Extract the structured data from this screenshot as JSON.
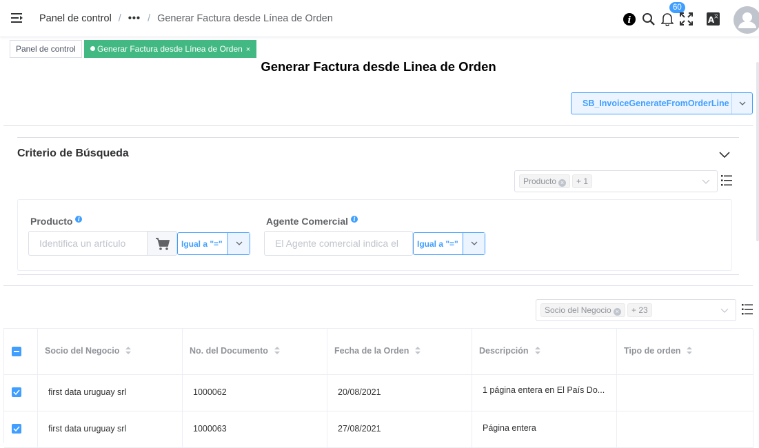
{
  "breadcrumb": {
    "home": "Panel de control",
    "ellipsis": "•••",
    "current": "Generar Factura desde Línea de Orden"
  },
  "header": {
    "notifications_count": "60"
  },
  "tabs": [
    {
      "label": "Panel de control",
      "active": false
    },
    {
      "label": "Generar Factura desde Línea de Orden",
      "active": true,
      "close": "×"
    }
  ],
  "page_title": "Generar Factura desde Linea de Orden",
  "process_select": {
    "value": "SB_InvoiceGenerateFromOrderLine"
  },
  "search_criteria": {
    "title": "Criterio de Búsqueda",
    "field_selector": {
      "chip": "Producto",
      "more": "+ 1"
    },
    "fields": {
      "product": {
        "label": "Producto",
        "placeholder": "Identifica un artículo",
        "operator": "Igual a \"=\""
      },
      "agent": {
        "label": "Agente Comercial",
        "placeholder": "El Agente comercial indica el",
        "operator": "Igual a \"=\""
      }
    }
  },
  "table": {
    "column_selector": {
      "chip": "Socio del Negocio",
      "more": "+ 23"
    },
    "columns": [
      "Socio del Negocio",
      "No. del Documento",
      "Fecha de la Orden",
      "Descripción",
      "Tipo de orden"
    ],
    "rows": [
      {
        "checked": true,
        "cells": [
          "first data uruguay srl",
          "1000062",
          "20/08/2021",
          "1 página entera en El País Do...",
          ""
        ]
      },
      {
        "checked": true,
        "cells": [
          "first data uruguay srl",
          "1000063",
          "27/08/2021",
          "Página entera",
          ""
        ]
      }
    ]
  },
  "colors": {
    "primary": "#409eff",
    "tag_active": "#42b983"
  }
}
